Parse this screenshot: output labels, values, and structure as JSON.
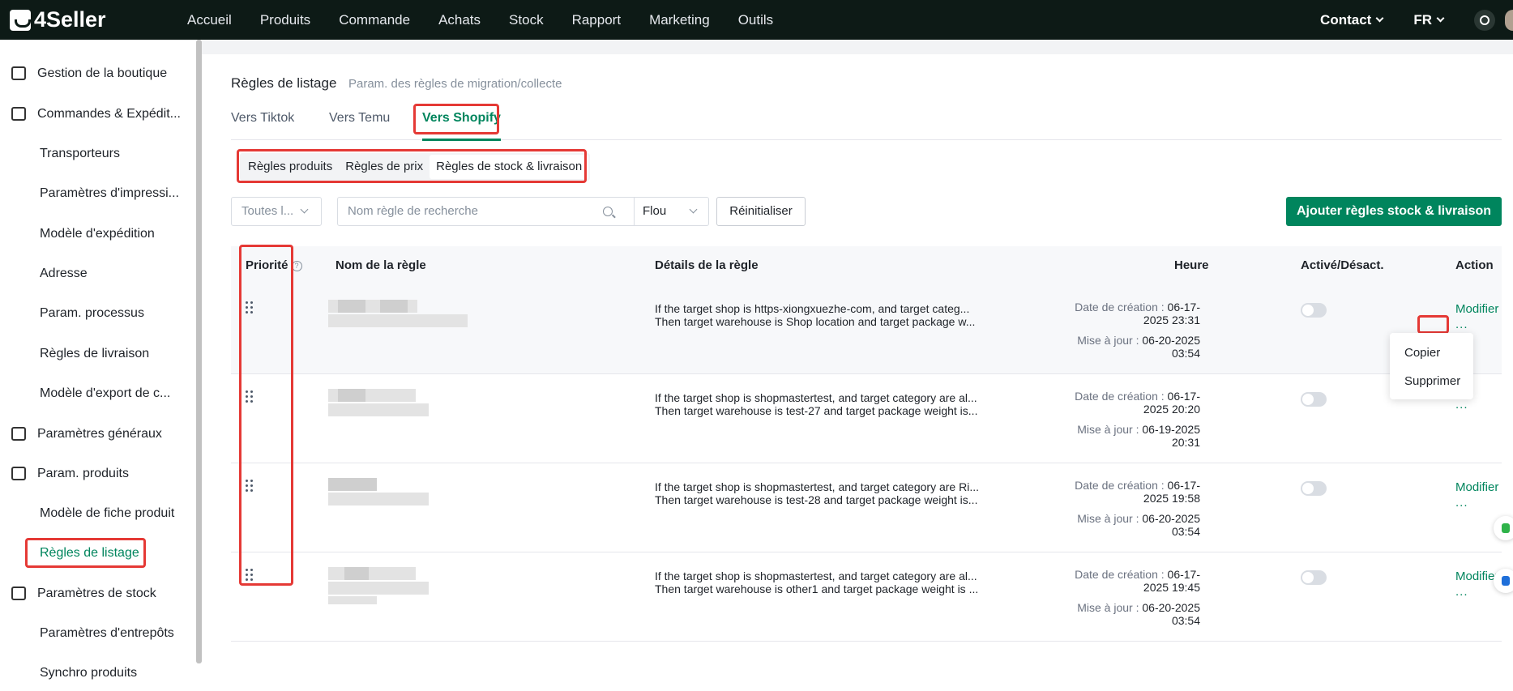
{
  "brand": "4Seller",
  "topnav": [
    "Accueil",
    "Produits",
    "Commande",
    "Achats",
    "Stock",
    "Rapport",
    "Marketing",
    "Outils"
  ],
  "topright": {
    "contact": "Contact",
    "lang": "FR"
  },
  "sidebar": {
    "items": [
      {
        "label": "Gestion de la boutique"
      },
      {
        "label": "Commandes & Expédit..."
      },
      {
        "label": "Transporteurs"
      },
      {
        "label": "Paramètres d'impressi..."
      },
      {
        "label": "Modèle d'expédition"
      },
      {
        "label": "Adresse"
      },
      {
        "label": "Param. processus"
      },
      {
        "label": "Règles de livraison"
      },
      {
        "label": "Modèle d'export de c..."
      },
      {
        "label": "Paramètres généraux"
      },
      {
        "label": "Param. produits"
      },
      {
        "label": "Modèle de fiche produit"
      },
      {
        "label": "Règles de listage"
      },
      {
        "label": "Paramètres de stock"
      },
      {
        "label": "Paramètres d'entrepôts"
      },
      {
        "label": "Synchro produits"
      }
    ]
  },
  "page": {
    "title": "Règles de listage",
    "subtitle": "Param. des règles de migration/collecte",
    "tabs": [
      "Vers Tiktok",
      "Vers Temu",
      "Vers Shopify"
    ],
    "segments": [
      "Règles produits",
      "Règles de prix",
      "Règles de stock & livraison"
    ]
  },
  "filters": {
    "shop_select": "Toutes l...",
    "search_placeholder": "Nom règle de recherche",
    "match_select": "Flou",
    "reset": "Réinitialiser",
    "add": "Ajouter règles stock & livraison"
  },
  "table": {
    "headers": {
      "priority": "Priorité",
      "name": "Nom de la règle",
      "details": "Détails de la règle",
      "time": "Heure",
      "toggle": "Activé/Désact.",
      "action": "Action"
    },
    "created_label": "Date de création :",
    "updated_label": "Mise à jour :",
    "modify": "Modifier",
    "more": "...",
    "rows": [
      {
        "detail1": "If the target shop is https-xiongxuezhe-com, and target categ...",
        "detail2": "Then target warehouse is Shop location and target package w...",
        "created_date": "06-17-",
        "created_time": "2025 23:31",
        "updated_date": "06-20-2025",
        "updated_time": "03:54"
      },
      {
        "detail1": "If the target shop is shopmastertest, and target category are al...",
        "detail2": "Then target warehouse is test-27 and target package weight is...",
        "created_date": "06-17-",
        "created_time": "2025 20:20",
        "updated_date": "06-19-2025",
        "updated_time": "20:31"
      },
      {
        "detail1": "If the target shop is shopmastertest, and target category are Ri...",
        "detail2": "Then target warehouse is test-28 and target package weight is...",
        "created_date": "06-17-",
        "created_time": "2025 19:58",
        "updated_date": "06-20-2025",
        "updated_time": "03:54"
      },
      {
        "detail1": "If the target shop is shopmastertest, and target category are al...",
        "detail2": "Then target warehouse is other1 and target package weight is ...",
        "created_date": "06-17-",
        "created_time": "2025 19:45",
        "updated_date": "06-20-2025",
        "updated_time": "03:54"
      }
    ]
  },
  "dropdown": {
    "copy": "Copier",
    "delete": "Supprimer"
  },
  "colors": {
    "accent": "#00855d",
    "highlight": "#e53935",
    "topbar": "#0d1a16"
  }
}
